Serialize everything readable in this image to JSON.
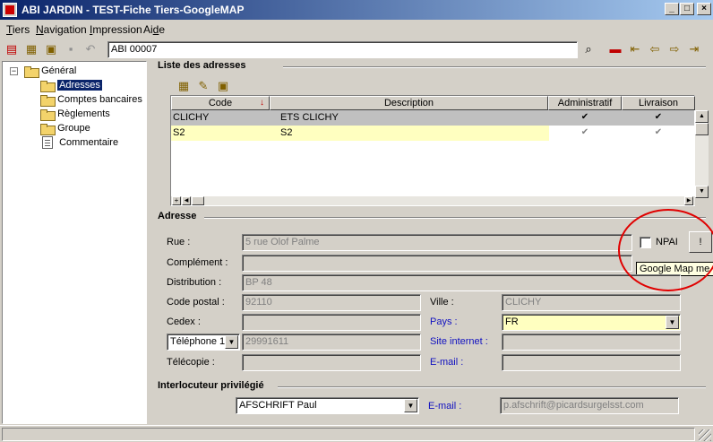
{
  "window": {
    "title": "ABI JARDIN - TEST-Fiche Tiers-GoogleMAP",
    "minimize": "_",
    "maximize": "□",
    "close": "×"
  },
  "menu": {
    "items": [
      {
        "label": "Tiers",
        "u": "T",
        "rest": "iers"
      },
      {
        "label": "Navigation",
        "u": "N",
        "rest": "avigation"
      },
      {
        "label": "Impression",
        "u": "I",
        "rest": "mpression"
      },
      {
        "label": "Aide",
        "pre": "Ai",
        "u": "d",
        "rest": "e"
      }
    ]
  },
  "toolbar": {
    "tiers_value": "ABI 00007"
  },
  "tree": {
    "root": "Général",
    "items": [
      "Adresses",
      "Comptes bancaires",
      "Règlements",
      "Groupe",
      "Commentaire"
    ],
    "expander": "−"
  },
  "addresses_section": {
    "title": "Liste des adresses"
  },
  "grid": {
    "columns": [
      "Code",
      "Description",
      "Administratif",
      "Livraison"
    ],
    "sort_marker": "↓",
    "rows": [
      {
        "code": "CLICHY",
        "description": "ETS CLICHY",
        "administratif": "✔",
        "livraison": "✔"
      },
      {
        "code": "S2",
        "description": "S2",
        "administratif": "✔",
        "livraison": "✔"
      }
    ],
    "plus": "+"
  },
  "address": {
    "title": "Adresse",
    "rue_label": "Rue :",
    "rue_value": "5 rue Olof Palme",
    "complement_label": "Complément :",
    "complement_value": "",
    "distribution_label": "Distribution :",
    "distribution_value": "BP 48",
    "code_postal_label": "Code postal :",
    "code_postal_value": "92110",
    "ville_label": "Ville :",
    "ville_value": "CLICHY",
    "cedex_label": "Cedex :",
    "cedex_value": "",
    "pays_label": "Pays :",
    "pays_value": "FR",
    "phone_type": "Téléphone 1",
    "phone_value": "29991611",
    "site_label": "Site internet :",
    "site_value": "",
    "fax_label": "Télécopie :",
    "fax_value": "",
    "email_label": "E-mail :",
    "email_value": "",
    "npai_label": "NPAI",
    "map_button": "!",
    "map_tooltip": "Google Map me !"
  },
  "contact": {
    "title": "Interlocuteur privilégié",
    "name": "AFSCHRIFT Paul",
    "email_label": "E-mail :",
    "email_value": "p.afschrift@picardsurgelsst.com"
  },
  "colors": {
    "title_start": "#0a246a",
    "title_end": "#a6caf0",
    "selected_row": "#c0c0c0",
    "highlight_row": "#ffffc0",
    "annotation": "#e00000"
  }
}
